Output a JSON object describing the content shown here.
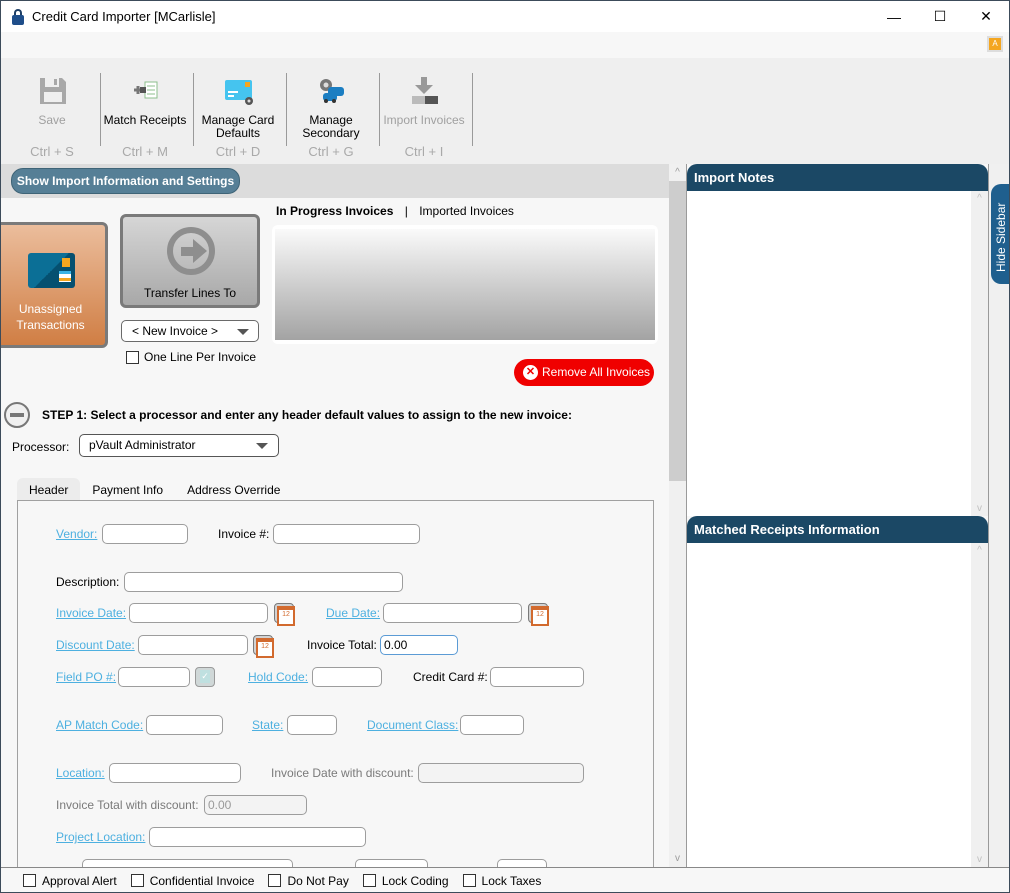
{
  "window": {
    "title": "Credit Card Importer [MCarlisle]",
    "controls": {
      "minimize": "—",
      "maximize": "☐",
      "close": "✕"
    },
    "badge": "A"
  },
  "toolbar": {
    "buttons": [
      {
        "label": "Save",
        "shortcut": "Ctrl + S",
        "icon": "save-icon",
        "enabled": false
      },
      {
        "label": "Match Receipts",
        "shortcut": "Ctrl + M",
        "icon": "match-receipts-icon",
        "enabled": true
      },
      {
        "label": "Manage Card Defaults",
        "shortcut": "Ctrl + D",
        "icon": "card-settings-icon",
        "enabled": true
      },
      {
        "label": "Manage Secondary",
        "shortcut": "Ctrl + G",
        "icon": "secondary-settings-icon",
        "enabled": true
      },
      {
        "label": "Import Invoices",
        "shortcut": "Ctrl + I",
        "icon": "import-icon",
        "enabled": false
      }
    ]
  },
  "main": {
    "show_settings_button": "Show Import Information and Settings",
    "unassigned_label": "Unassigned Transactions",
    "transfer_label": "Transfer Lines To",
    "transfer_target": "< New Invoice >",
    "one_line_per_invoice": {
      "label": "One Line Per Invoice",
      "checked": false
    },
    "invoice_tabs": {
      "active": "In Progress Invoices",
      "separator": "|",
      "other": "Imported Invoices"
    },
    "remove_all_button": "Remove All Invoices",
    "step1": "STEP 1: Select a processor and enter any header default values to assign to the new invoice:",
    "processor": {
      "label": "Processor:",
      "value": "pVault Administrator"
    },
    "tabs": [
      "Header",
      "Payment Info",
      "Address Override"
    ],
    "active_tab": "Header",
    "fields": {
      "vendor": {
        "label": "Vendor:",
        "value": ""
      },
      "invoice_no": {
        "label": "Invoice #:",
        "value": ""
      },
      "description": {
        "label": "Description:",
        "value": ""
      },
      "invoice_date": {
        "label": "Invoice Date:",
        "value": ""
      },
      "due_date": {
        "label": "Due Date:",
        "value": ""
      },
      "discount_date": {
        "label": "Discount Date:",
        "value": ""
      },
      "invoice_total": {
        "label": "Invoice Total:",
        "value": "0.00"
      },
      "field_po": {
        "label": "Field PO #:",
        "value": ""
      },
      "hold_code": {
        "label": "Hold Code:",
        "value": ""
      },
      "credit_card": {
        "label": "Credit Card #:",
        "value": ""
      },
      "ap_match_code": {
        "label": "AP Match Code:",
        "value": ""
      },
      "state": {
        "label": "State:",
        "value": ""
      },
      "document_class": {
        "label": "Document Class:",
        "value": ""
      },
      "location": {
        "label": "Location:",
        "value": ""
      },
      "invoice_date_discount": {
        "label": "Invoice Date with discount:",
        "value": ""
      },
      "invoice_total_discount": {
        "label": "Invoice Total with discount:",
        "value": "0.00"
      },
      "project_location": {
        "label": "Project Location:",
        "value": ""
      }
    }
  },
  "sidebar": {
    "import_notes_title": "Import Notes",
    "matched_receipts_title": "Matched Receipts Information",
    "hide_button": "Hide Sidebar"
  },
  "footer": {
    "checkboxes": [
      {
        "label": "Approval Alert",
        "checked": false
      },
      {
        "label": "Confidential Invoice",
        "checked": false
      },
      {
        "label": "Do Not Pay",
        "checked": false
      },
      {
        "label": "Lock Coding",
        "checked": false
      },
      {
        "label": "Lock Taxes",
        "checked": false
      }
    ]
  }
}
